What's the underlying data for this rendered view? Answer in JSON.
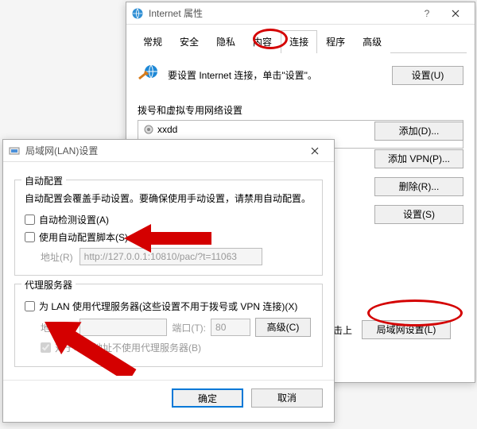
{
  "parent": {
    "title": "Internet 属性",
    "tabs": [
      "常规",
      "安全",
      "隐私",
      "内容",
      "连接",
      "程序",
      "高级"
    ],
    "active_tab_index": 4,
    "setup_text": "要设置 Internet 连接，单击\"设置\"。",
    "setup_button": "设置(U)",
    "dialup_section_label": "拨号和虚拟专用网络设置",
    "dialup_item": "xxdd",
    "side_buttons": {
      "add": "添加(D)...",
      "add_vpn": "添加 VPN(P)...",
      "delete": "删除(R)...",
      "settings": "设置(S)"
    },
    "lan_note_suffix": "击上",
    "lan_settings_button": "局域网设置(L)"
  },
  "lan": {
    "title": "局域网(LAN)设置",
    "auto_group": "自动配置",
    "auto_desc": "自动配置会覆盖手动设置。要确保使用手动设置，请禁用自动配置。",
    "auto_detect": "自动检测设置(A)",
    "auto_script": "使用自动配置脚本(S)",
    "addr_label": "地址(R)",
    "script_url": "http://127.0.0.1:10810/pac/?t=11063",
    "proxy_group": "代理服务器",
    "proxy_use": "为 LAN 使用代理服务器(这些设置不用于拨号或 VPN 连接)(X)",
    "addr2_label": "地址(E):",
    "port_label": "端口(T):",
    "port_value": "80",
    "advanced": "高级(C)",
    "bypass_local": "对于本地地址不使用代理服务器(B)",
    "ok": "确定",
    "cancel": "取消"
  }
}
